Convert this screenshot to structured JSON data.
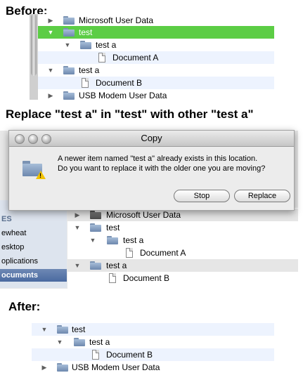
{
  "headings": {
    "before": "Before:",
    "replace": "Replace \"test a\" in \"test\" with other \"test a\"",
    "after": "After:"
  },
  "before_panel": {
    "rows": [
      {
        "label": "Microsoft User Data",
        "type": "folder",
        "expand": "closed"
      },
      {
        "label": "test",
        "type": "folder",
        "expand": "open",
        "selected": true
      },
      {
        "label": "test a",
        "type": "folder",
        "expand": "open"
      },
      {
        "label": "Document A",
        "type": "document"
      },
      {
        "label": "test a",
        "type": "folder",
        "expand": "open"
      },
      {
        "label": "Document B",
        "type": "document"
      },
      {
        "label": "USB Modem User Data",
        "type": "folder",
        "expand": "closed"
      }
    ]
  },
  "dialog": {
    "title": "Copy",
    "line1": "A newer item named \"test a\" already exists in this location.",
    "line2": "Do you want to replace it with the older one you are moving?",
    "stop_label": "Stop",
    "replace_label": "Replace"
  },
  "sidebar": {
    "items": [
      {
        "label": "ES",
        "kind": "head"
      },
      {
        "label": "ewheat",
        "kind": "item"
      },
      {
        "label": "esktop",
        "kind": "item"
      },
      {
        "label": "oplications",
        "kind": "item"
      },
      {
        "label": "ocuments",
        "kind": "selected"
      }
    ]
  },
  "middle_panel": {
    "rows": [
      {
        "label": "Microsoft User Data",
        "type": "folder",
        "expand": "closed"
      },
      {
        "label": "test",
        "type": "folder",
        "expand": "open"
      },
      {
        "label": "test a",
        "type": "folder",
        "expand": "open"
      },
      {
        "label": "Document A",
        "type": "document"
      },
      {
        "label": "test a",
        "type": "folder",
        "expand": "open"
      },
      {
        "label": "Document B",
        "type": "document"
      }
    ]
  },
  "after_panel": {
    "rows": [
      {
        "label": "test",
        "type": "folder",
        "expand": "open"
      },
      {
        "label": "test a",
        "type": "folder",
        "expand": "open"
      },
      {
        "label": "Document B",
        "type": "document"
      },
      {
        "label": "USB Modem User Data",
        "type": "folder",
        "expand": "closed"
      }
    ]
  },
  "colors": {
    "selection": "#5ccd45",
    "folder": "#8aa3c4",
    "sidebar_selected": "#4a6aa0"
  }
}
